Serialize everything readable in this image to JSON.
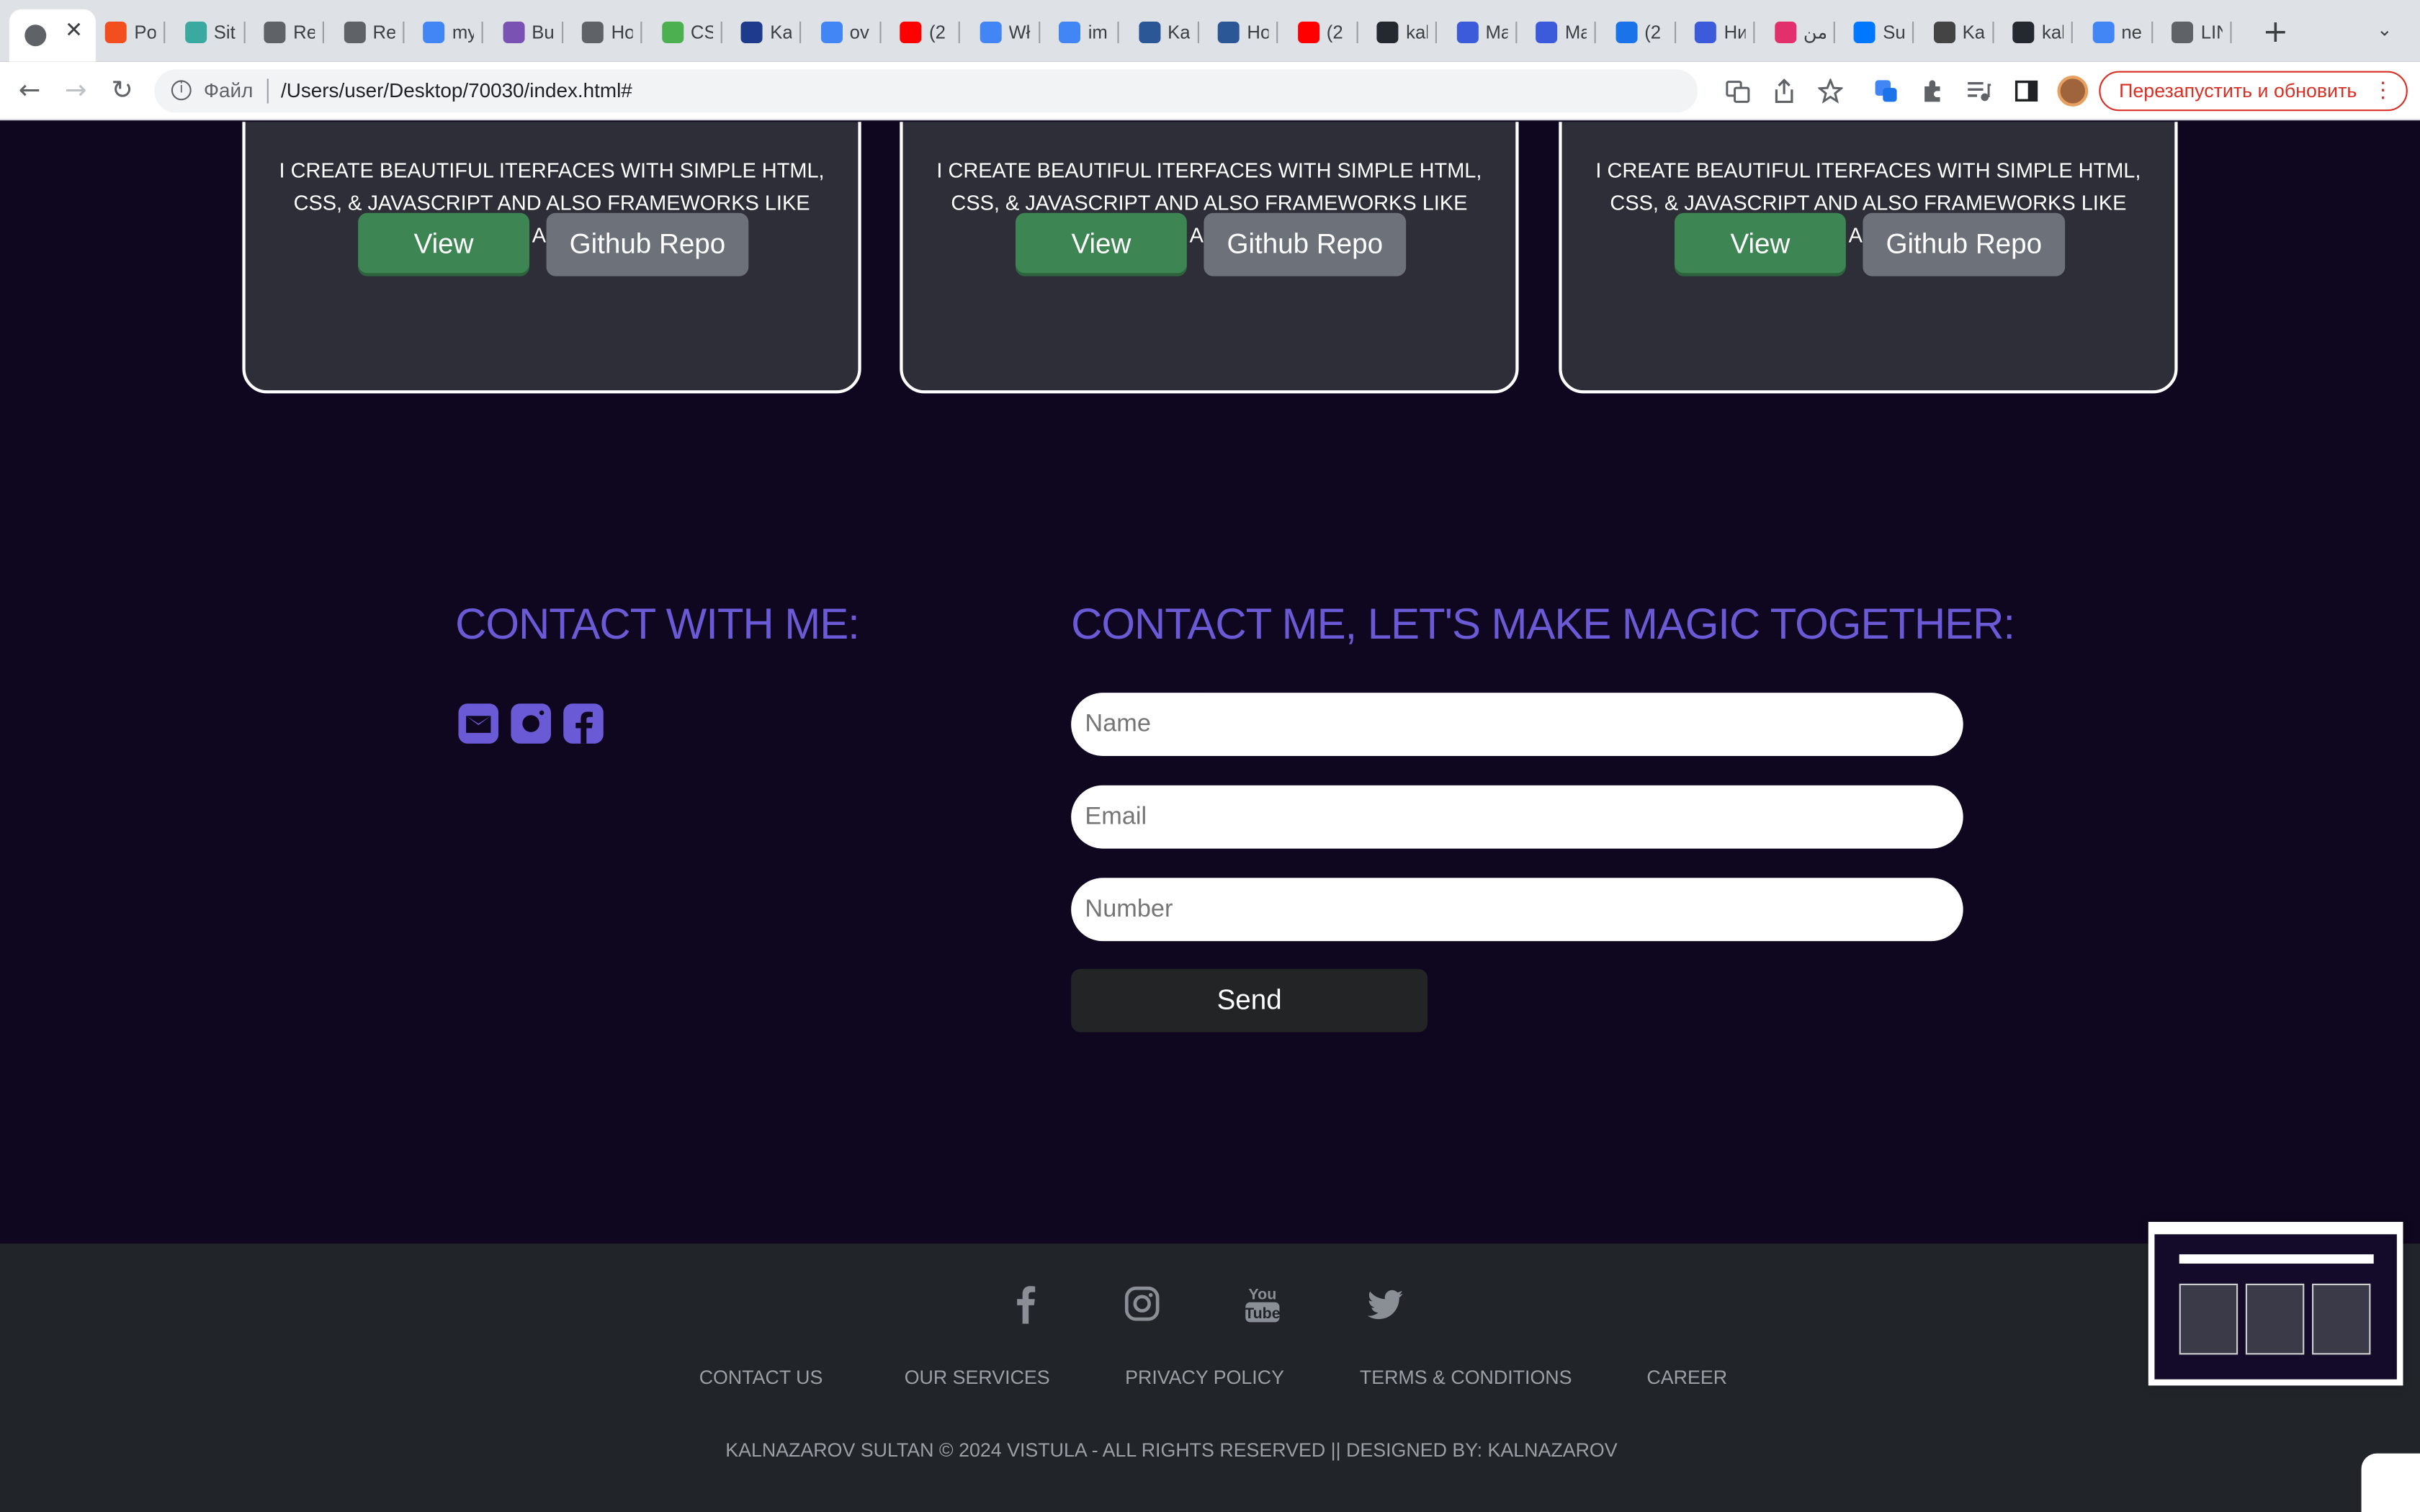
{
  "browser": {
    "tabs": [
      {
        "label": "Po",
        "color": "#f24e1e"
      },
      {
        "label": "Sit",
        "color": "#3aa99f"
      },
      {
        "label": "Re",
        "color": "#5f6368"
      },
      {
        "label": "Re",
        "color": "#5f6368"
      },
      {
        "label": "my",
        "color": "#4285f4"
      },
      {
        "label": "Bu",
        "color": "#7952b3"
      },
      {
        "label": "Ho",
        "color": "#5f6368"
      },
      {
        "label": "CS",
        "color": "#4caf50"
      },
      {
        "label": "Ka",
        "color": "#1e3a8a"
      },
      {
        "label": "ov",
        "color": "#4285f4"
      },
      {
        "label": "(2",
        "color": "#ff0000"
      },
      {
        "label": "Wł",
        "color": "#4285f4"
      },
      {
        "label": "im",
        "color": "#4285f4"
      },
      {
        "label": "Ka",
        "color": "#2b5797"
      },
      {
        "label": "Ho",
        "color": "#2b5797"
      },
      {
        "label": "(2",
        "color": "#ff0000"
      },
      {
        "label": "kal",
        "color": "#24292f"
      },
      {
        "label": "Ma",
        "color": "#3b5bdb"
      },
      {
        "label": "Ma",
        "color": "#3b5bdb"
      },
      {
        "label": "(2",
        "color": "#1a73e8"
      },
      {
        "label": "Ни",
        "color": "#3b5bdb"
      },
      {
        "label": "من",
        "color": "#e1306c"
      },
      {
        "label": "Su",
        "color": "#0077ff"
      },
      {
        "label": "Ka",
        "color": "#444"
      },
      {
        "label": "kal",
        "color": "#24292f"
      },
      {
        "label": "ne",
        "color": "#4285f4"
      },
      {
        "label": "LIN",
        "color": "#5f6368"
      }
    ],
    "new_tab": "+",
    "tab_list": "⌄",
    "close_tab": "✕",
    "back": "←",
    "forward": "→",
    "reload": "↻",
    "scheme_label": "Файл",
    "url": "/Users/user/Desktop/70030/index.html#",
    "relaunch_label": "Перезапустить и обновить",
    "menu": "⋮"
  },
  "projects": [
    {
      "description": "I CREATE BEAUTIFUL ITERFACES WITH SIMPLE HTML, CSS, & JAVASCRIPT AND ALSO FRAMEWORKS LIKE ANGULAR AND REACTJS",
      "view_label": "View",
      "repo_label": "Github Repo"
    },
    {
      "description": "I CREATE BEAUTIFUL ITERFACES WITH SIMPLE HTML, CSS, & JAVASCRIPT AND ALSO FRAMEWORKS LIKE ANGULAR AND REACTJS",
      "view_label": "View",
      "repo_label": "Github Repo"
    },
    {
      "description": "I CREATE BEAUTIFUL ITERFACES WITH SIMPLE HTML, CSS, & JAVASCRIPT AND ALSO FRAMEWORKS LIKE ANGULAR AND REACTJS",
      "view_label": "View",
      "repo_label": "Github Repo"
    }
  ],
  "contact": {
    "left_heading": "CONTACT WITH ME:",
    "right_heading": "CONTACT ME, LET'S MAKE MAGIC TOGETHER:",
    "icons": [
      "mail-icon",
      "instagram-icon",
      "facebook-icon"
    ],
    "accent": "#6b5ad6",
    "form": {
      "name_placeholder": "Name",
      "email_placeholder": "Email",
      "number_placeholder": "Number",
      "send_label": "Send"
    }
  },
  "footer": {
    "social_icons": [
      "facebook-icon",
      "instagram-icon",
      "youtube-icon",
      "twitter-icon"
    ],
    "links": [
      "CONTACT US",
      "OUR SERVICES",
      "PRIVACY POLICY",
      "TERMS & CONDITIONS",
      "CAREER"
    ],
    "copyright": "KALNAZAROV SULTAN © 2024 VISTULA - ALL RIGHTS RESERVED || DESIGNED BY: KALNAZAROV"
  },
  "colors": {
    "page_bg": "#0f0620",
    "card_bg": "#2e2e38",
    "view_button": "#3d8552",
    "repo_button": "#6c717a",
    "footer_bg": "#212529"
  }
}
